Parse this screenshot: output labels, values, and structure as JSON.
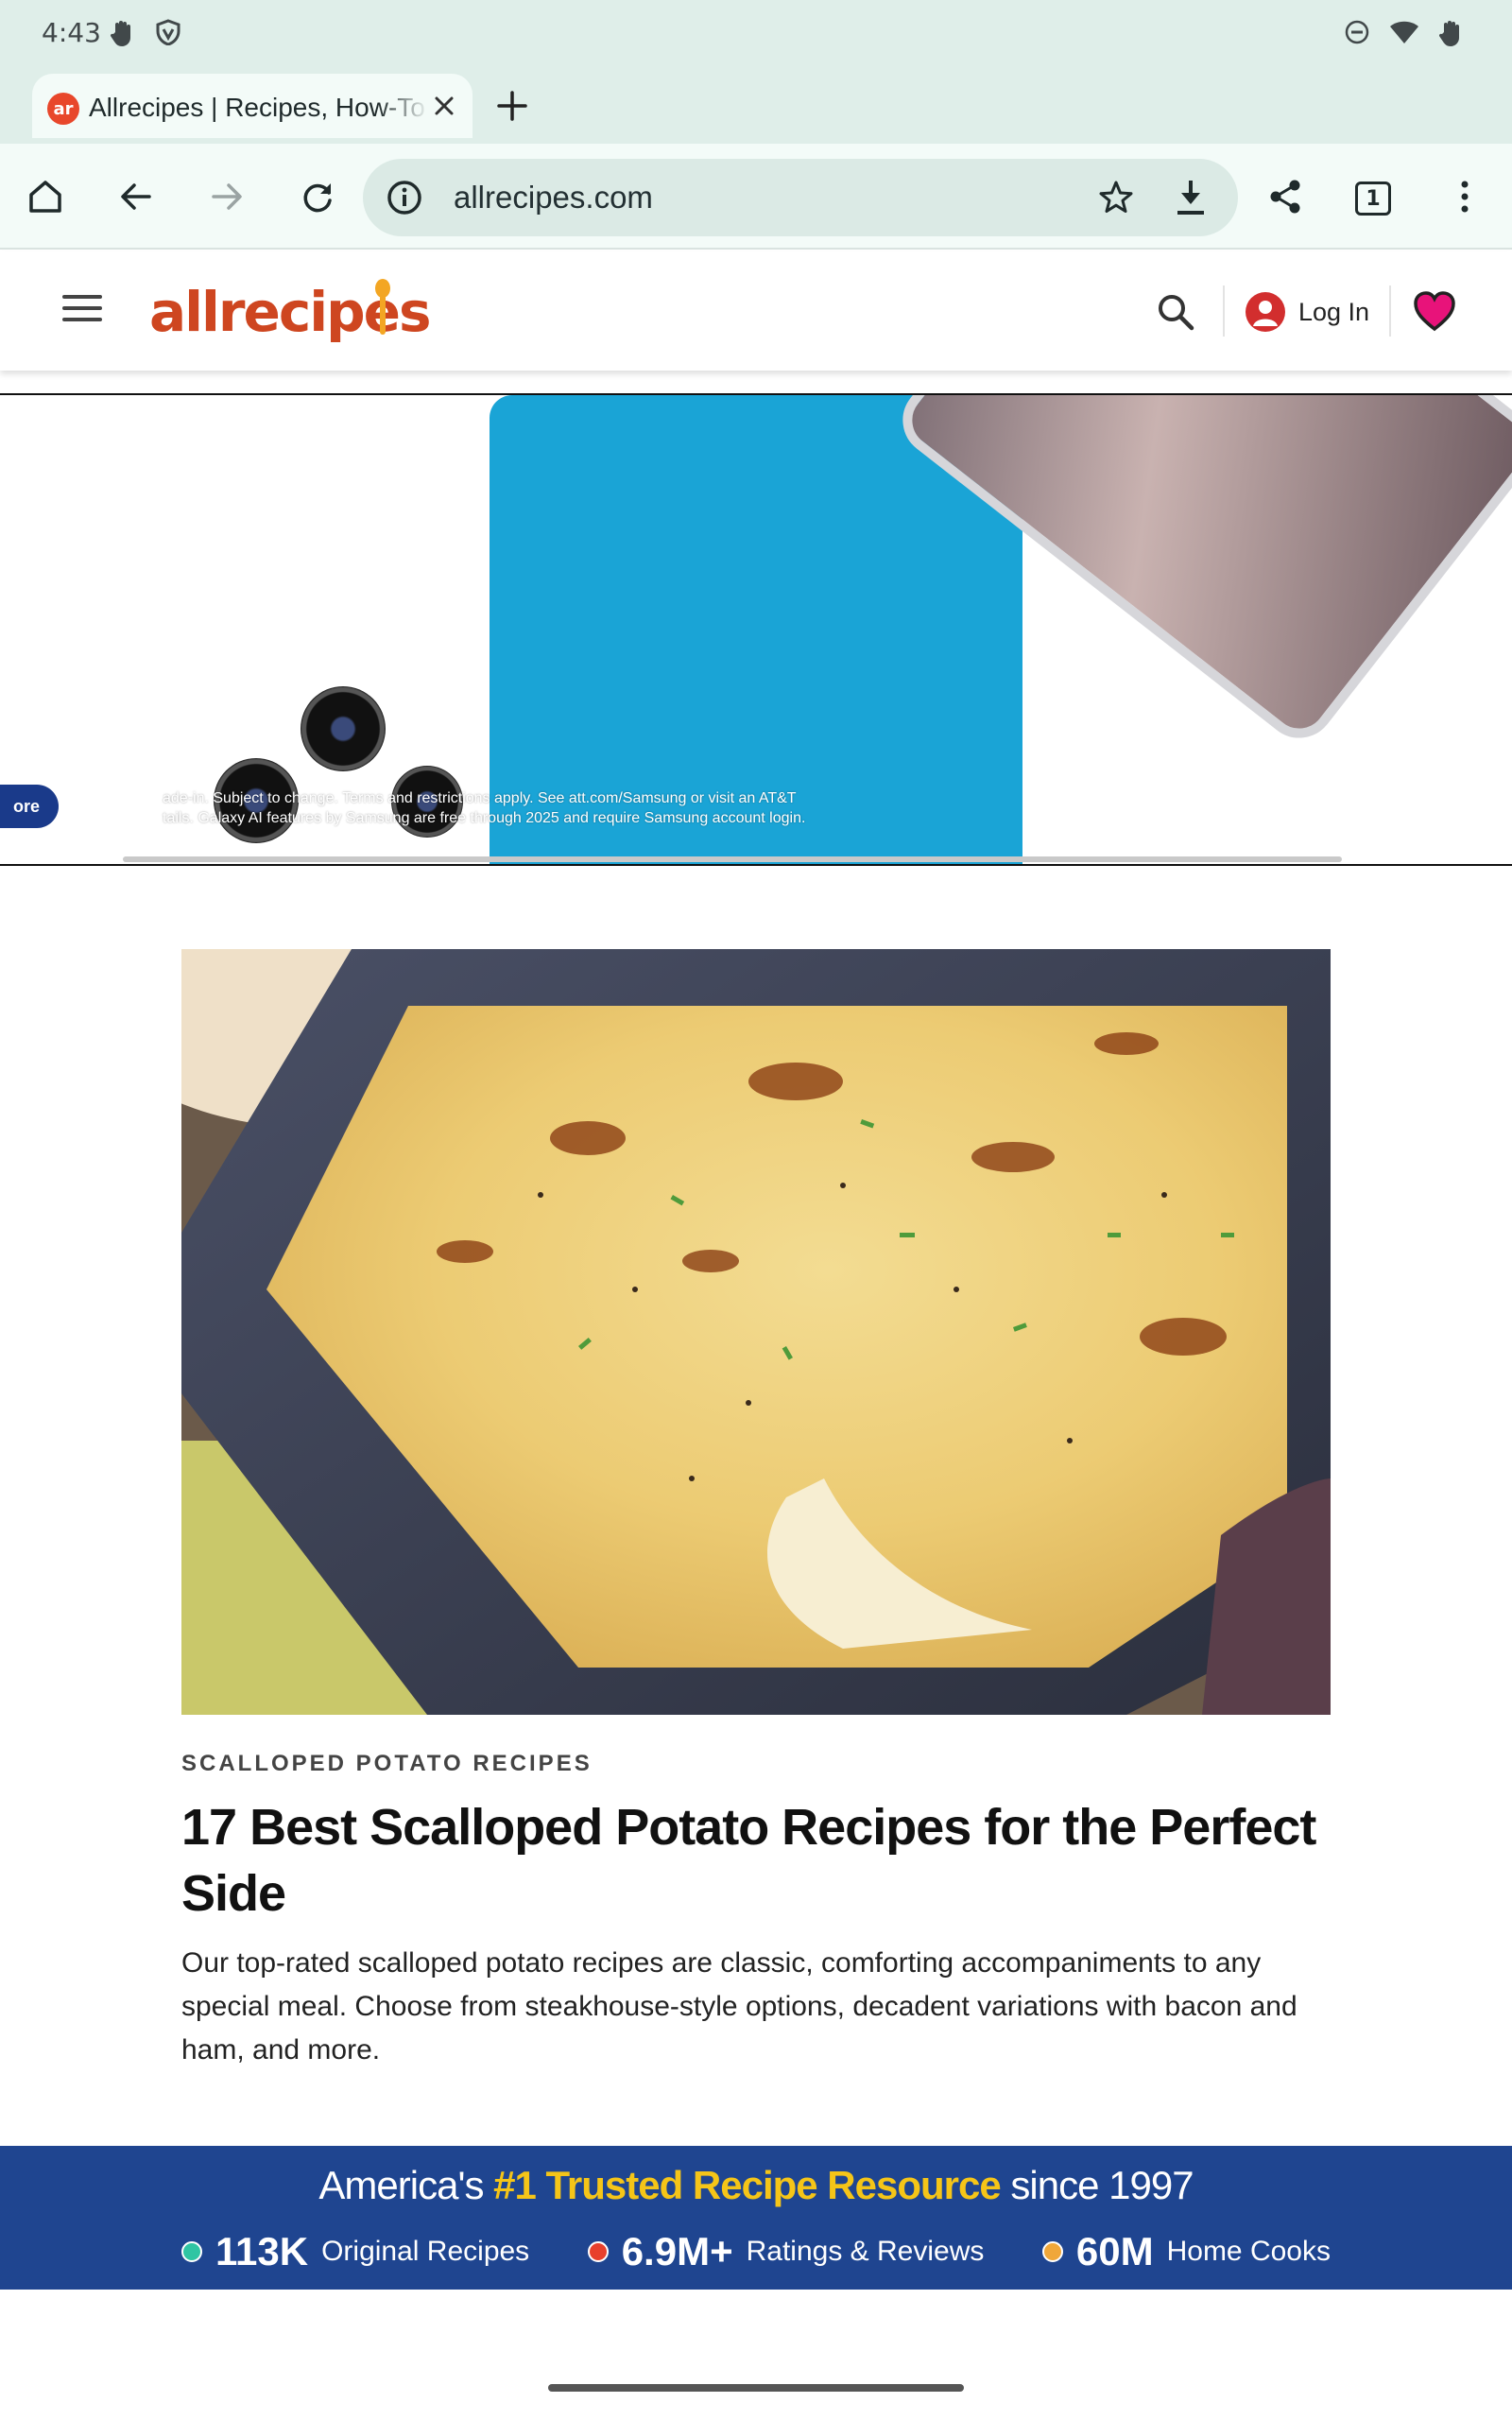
{
  "status_bar": {
    "time": "4:43",
    "left_icons": [
      "hand-icon",
      "shield-icon"
    ],
    "right_icons": [
      "do-not-disturb-icon",
      "wifi-icon",
      "battery-icon"
    ]
  },
  "browser": {
    "tab": {
      "title": "Allrecipes | Recipes, How-To",
      "favicon_text": "ar"
    },
    "url": "allrecipes.com",
    "tab_count": "1",
    "icons": [
      "home-icon",
      "back-icon",
      "forward-icon",
      "reload-icon",
      "info-icon",
      "star-icon",
      "download-icon",
      "share-icon",
      "menu-icon"
    ]
  },
  "site_header": {
    "logo": "allrecipes",
    "login_label": "Log In",
    "accent": "#ce4620"
  },
  "ad": {
    "more_label": "ore",
    "disclaimer_line1": "ade-in. Subject to change. Terms and restrictions apply. See att.com/Samsung or visit an AT&T",
    "disclaimer_line2": "tails. Galaxy AI features by Samsung are free through 2025 and require Samsung account login.",
    "panel_color": "#1aa4d6"
  },
  "article": {
    "kicker": "SCALLOPED POTATO RECIPES",
    "headline": "17 Best Scalloped Potato Recipes for the Perfect Side",
    "dek": "Our top-rated scalloped potato recipes are classic, comforting accompaniments to any special meal. Choose from steakhouse-style options, decadent variations with bacon and ham, and more."
  },
  "banner": {
    "prefix": "America's",
    "highlight": "#1 Trusted Recipe Resource",
    "suffix": "since 1997",
    "background": "#1f4590",
    "highlight_color": "#f5c518",
    "stats": [
      {
        "number": "113K",
        "label": "Original Recipes",
        "dot_color": "#2fc5a3"
      },
      {
        "number": "6.9M+",
        "label": "Ratings & Reviews",
        "dot_color": "#e8402c"
      },
      {
        "number": "60M",
        "label": "Home Cooks",
        "dot_color": "#f0a73a"
      }
    ]
  }
}
